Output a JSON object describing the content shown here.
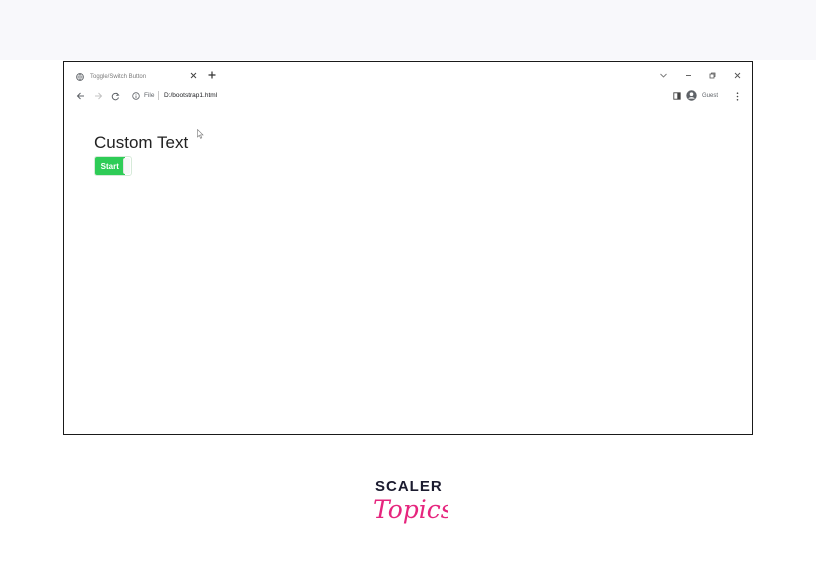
{
  "browser": {
    "tab_title": "Toggle/Switch Button",
    "address_scheme_label": "File",
    "address_url": "D:/bootstrap1.html",
    "profile_label": "Guest"
  },
  "page": {
    "heading": "Custom Text",
    "toggle": {
      "label": "Start",
      "fill_fraction": 0.82,
      "color": "#2ecc56"
    }
  },
  "branding": {
    "logo_top": "SCALER",
    "logo_bottom": "Topics",
    "logo_top_color": "#1b1b2f",
    "logo_bottom_color": "#e6257e"
  }
}
